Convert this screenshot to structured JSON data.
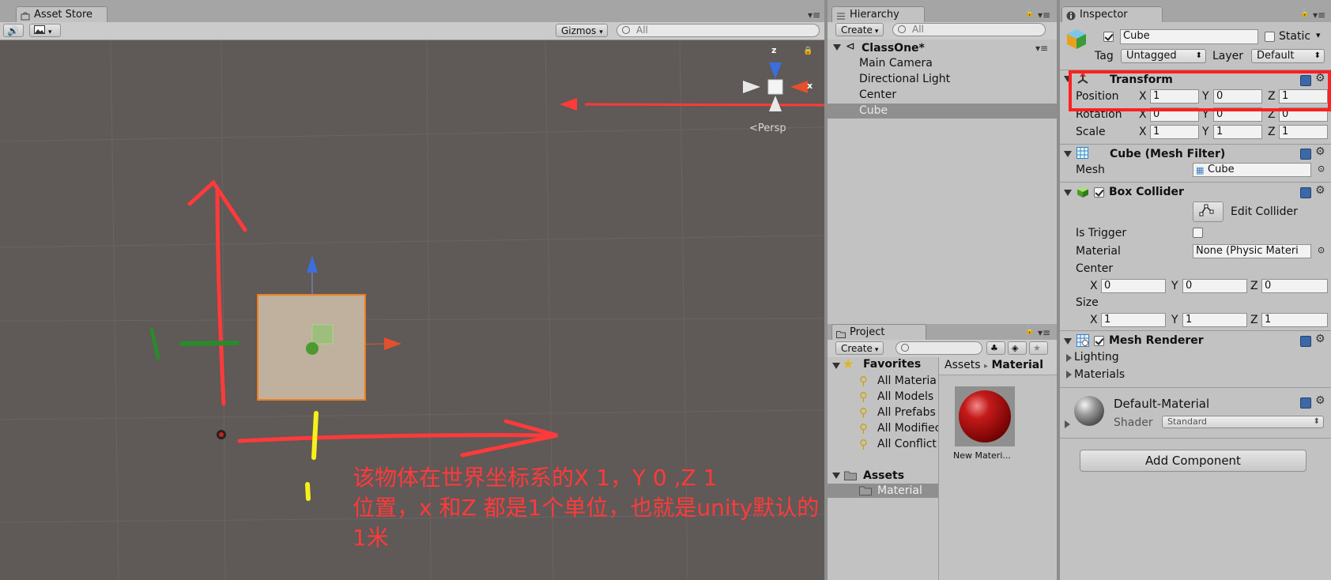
{
  "scene_panel": {
    "tab_label": "Asset Store",
    "gizmos_label": "Gizmos",
    "search_placeholder": "All",
    "persp_label": "Persp",
    "axis_z": "z",
    "axis_x": "x"
  },
  "annotation": {
    "line1": "该物体在世界坐标系的X 1，Y 0 ,Z 1",
    "line2": "位置，x 和Z 都是1个单位，也就是unity默认的",
    "line3": "1米"
  },
  "hierarchy": {
    "tab_label": "Hierarchy",
    "create_label": "Create",
    "search_placeholder": "All",
    "scene_name": "ClassOne*",
    "items": [
      {
        "label": "Main Camera"
      },
      {
        "label": "Directional Light"
      },
      {
        "label": "Center"
      },
      {
        "label": "Cube"
      }
    ]
  },
  "project": {
    "tab_label": "Project",
    "create_label": "Create",
    "favorites_label": "Favorites",
    "favorites": [
      {
        "label": "All Materia"
      },
      {
        "label": "All Models"
      },
      {
        "label": "All Prefabs"
      },
      {
        "label": "All Modifiec"
      },
      {
        "label": "All Conflict"
      }
    ],
    "assets_label": "Assets",
    "assets_children": [
      {
        "label": "Material"
      }
    ],
    "breadcrumb": {
      "root": "Assets",
      "sep": "▸",
      "current": "Material"
    },
    "asset_items": [
      {
        "label": "New Materi..."
      }
    ]
  },
  "inspector": {
    "tab_label": "Inspector",
    "object_name": "Cube",
    "static_label": "Static",
    "tag_label": "Tag",
    "tag_value": "Untagged",
    "layer_label": "Layer",
    "layer_value": "Default",
    "transform": {
      "title": "Transform",
      "position_label": "Position",
      "rotation_label": "Rotation",
      "scale_label": "Scale",
      "axis_x": "X",
      "axis_y": "Y",
      "axis_z": "Z",
      "position": {
        "x": "1",
        "y": "0",
        "z": "1"
      },
      "rotation": {
        "x": "0",
        "y": "0",
        "z": "0"
      },
      "scale": {
        "x": "1",
        "y": "1",
        "z": "1"
      }
    },
    "mesh_filter": {
      "title": "Cube (Mesh Filter)",
      "mesh_label": "Mesh",
      "mesh_value": "Cube"
    },
    "box_collider": {
      "title": "Box Collider",
      "edit_collider_label": "Edit Collider",
      "is_trigger_label": "Is Trigger",
      "material_label": "Material",
      "material_value": "None (Physic Materi",
      "center_label": "Center",
      "size_label": "Size",
      "center": {
        "x": "0",
        "y": "0",
        "z": "0"
      },
      "size": {
        "x": "1",
        "y": "1",
        "z": "1"
      }
    },
    "mesh_renderer": {
      "title": "Mesh Renderer",
      "lighting_label": "Lighting",
      "materials_label": "Materials"
    },
    "material": {
      "name": "Default-Material",
      "shader_label": "Shader",
      "shader_value": "Standard"
    },
    "add_component_label": "Add Component"
  },
  "colors": {
    "scene_bg": "#5f5957",
    "annotation_red": "#ff3a3a",
    "selection": "#8f8f8f",
    "highlight_box": "#ff2020"
  }
}
